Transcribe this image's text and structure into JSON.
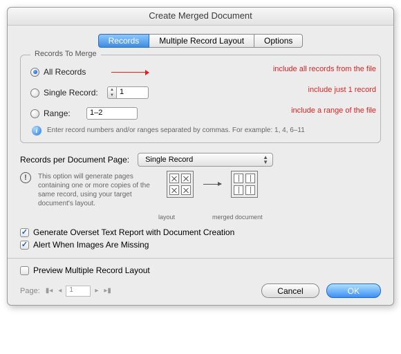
{
  "title": "Create Merged Document",
  "tabs": {
    "records": "Records",
    "layout": "Multiple Record Layout",
    "options": "Options"
  },
  "group": {
    "title": "Records To Merge",
    "all_label": "All Records",
    "single_label": "Single Record:",
    "single_value": "1",
    "range_label": "Range:",
    "range_value": "1–2",
    "info_text": "Enter record numbers and/or ranges separated by commas. For example: 1, 4, 6–11"
  },
  "annotations": {
    "all": "include all records from the file",
    "single": "include just 1 record",
    "range": "include a range of the file"
  },
  "rpp": {
    "label": "Records per Document Page:",
    "value": "Single Record",
    "explain": "This option will generate pages containing one or more copies of the same record, using your target document's layout.",
    "dg_layout": "layout",
    "dg_merged": "merged document"
  },
  "checks": {
    "overset": "Generate Overset Text Report with Document Creation",
    "missing": "Alert When Images Are Missing"
  },
  "preview_label": "Preview Multiple Record Layout",
  "pager": {
    "label": "Page:",
    "value": "1"
  },
  "buttons": {
    "cancel": "Cancel",
    "ok": "OK"
  }
}
